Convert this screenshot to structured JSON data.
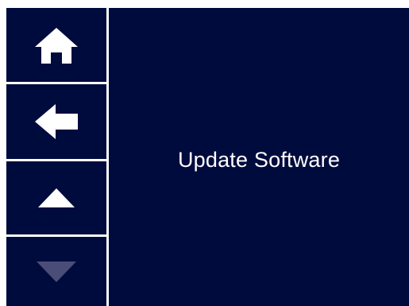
{
  "sidebar": {
    "buttons": [
      {
        "name": "home",
        "icon": "home-icon",
        "enabled": true
      },
      {
        "name": "back",
        "icon": "arrow-left-icon",
        "enabled": true
      },
      {
        "name": "scroll-up",
        "icon": "triangle-up-icon",
        "enabled": true
      },
      {
        "name": "scroll-down",
        "icon": "triangle-down-icon",
        "enabled": false
      }
    ]
  },
  "main": {
    "item_label": "Update Software"
  },
  "colors": {
    "background": "#000b3d",
    "foreground": "#ffffff",
    "disabled": "#4a4d78",
    "frame": "#ffffff"
  }
}
